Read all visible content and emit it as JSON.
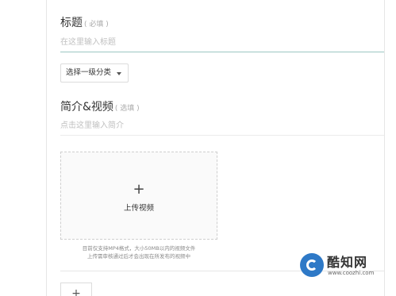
{
  "form": {
    "title_label": "标题",
    "title_hint": "( 必填 )",
    "title_placeholder": "在这里输入标题",
    "category_select": "选择一级分类",
    "intro_label": "简介&视频",
    "intro_hint": "( 选填 )",
    "intro_placeholder": "点击这里输入简介",
    "upload_plus": "+",
    "upload_label": "上传视频",
    "upload_note_line1": "目前仅支持MP4格式，大小50MB以内的视频文件",
    "upload_note_line2": "上传需审核通过后才会出现在所发布的视频中",
    "add_plus": "+"
  },
  "watermark": {
    "name": "酷知网",
    "url": "www.coozhi.com"
  },
  "icons": {
    "plus": "plus-icon",
    "caret": "caret-down-icon",
    "logo": "coozhi-logo-icon"
  },
  "colors": {
    "active_underline": "#9cc7c2",
    "logo_blue": "#2e79c7"
  }
}
